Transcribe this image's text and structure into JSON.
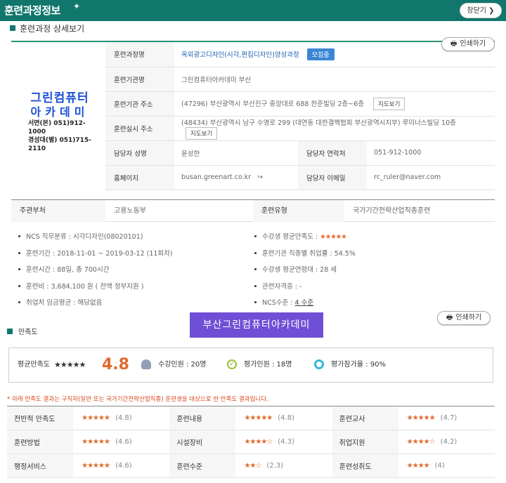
{
  "header": {
    "title": "훈련과정정보",
    "close_label": "창닫기 ❯",
    "sparkle": "✦"
  },
  "section": {
    "title": "훈련과정 상세보기",
    "print_label": "인쇄하기",
    "print_icon": "printer-icon"
  },
  "logo": {
    "line1": "그린컴퓨터",
    "line2": "아카데미",
    "line3": "서면(본) 051)912-1000",
    "line4": "경성대(별) 051)715-2110"
  },
  "info": {
    "course_name_label": "훈련과정명",
    "course_name": "옥외광고디자인(시각,편집디자인)양성과정",
    "status_badge": "모집중",
    "org_label": "훈련기관명",
    "org_name": "그린컴퓨터아카데미 부산",
    "org_addr_label": "훈련기관 주소",
    "org_addr": "(47296) 부산광역시 부산진구 중앙대로 688 한준빌딩 2층~6층",
    "site_addr_label": "훈련실시 주소",
    "site_addr": "(48434) 부산광역시 남구 수영로 299 (대연동 대한결핵협회 부산광역시지부) 루미너스빌딩 10층",
    "map_label": "지도보기",
    "manager_label": "담당자 성명",
    "manager": "윤성한",
    "contact_label": "담당자 연락처",
    "contact": "051-912-1000",
    "homepage_label": "홈페이지",
    "homepage": "busan.greenart.co.kr",
    "link_icon": "↪",
    "email_label": "담당자 이메일",
    "email": "rc_ruler@naver.com"
  },
  "dept": {
    "label": "주관부처",
    "value": "고용노동부",
    "type_label": "훈련유형",
    "type_value": "국가기간전략산업직종훈련"
  },
  "details_left": [
    "NCS 직무분류 : 시각디자인(08020101)",
    "훈련기간 : 2018-11-01 ~ 2019-03-12 (11회차)",
    "훈련시간 : 88일, 총 700시간",
    "훈련비 : 3,684,100 원 ( 전액 정부지원 )",
    "취업처 임금평균 : 해당없음"
  ],
  "details_right": {
    "satisfaction_label": "수강생 평균만족도 :",
    "satisfaction_stars": "★★★★★",
    "employment": "훈련기관 직종별 취업률 : 54.5%",
    "age": "수강생 평균연령대 : 28 세",
    "license": "관련자격증 : -",
    "ncs_level_label": "NCS수준 :",
    "ncs_level": "4 수준"
  },
  "satisfaction": {
    "title": "만족도",
    "banner": "부산그린컴퓨터아카데미",
    "print_label": "인쇄하기",
    "avg_label": "평균만족도",
    "avg_stars": "★★★★★",
    "avg_value": "4.8",
    "enrolled": "수강인원 : 20명",
    "evaluators": "평가인원 : 18명",
    "participation": "평가참가율 : 90%",
    "notice": "* 아래 만족도 결과는 구직자(일반 또는 국가기간전략산업직종) 훈련생을 대상으로 한 만족도 결과입니다.",
    "rows": [
      [
        {
          "label": "전반적 만족도",
          "stars": "★★★★★",
          "score": "(4.8)"
        },
        {
          "label": "훈련내용",
          "stars": "★★★★★",
          "score": "(4.8)"
        },
        {
          "label": "훈련교사",
          "stars": "★★★★★",
          "score": "(4.7)"
        }
      ],
      [
        {
          "label": "훈련방법",
          "stars": "★★★★★",
          "score": "(4.6)"
        },
        {
          "label": "시설장비",
          "stars": "★★★★☆",
          "score": "(4.3)"
        },
        {
          "label": "취업지원",
          "stars": "★★★★☆",
          "score": "(4.2)"
        }
      ],
      [
        {
          "label": "행정서비스",
          "stars": "★★★★★",
          "score": "(4.6)"
        },
        {
          "label": "훈련수준",
          "stars": "★★☆",
          "score": "(2.3)"
        },
        {
          "label": "훈련성취도",
          "stars": "★★★★",
          "score": "(4)"
        }
      ]
    ]
  }
}
